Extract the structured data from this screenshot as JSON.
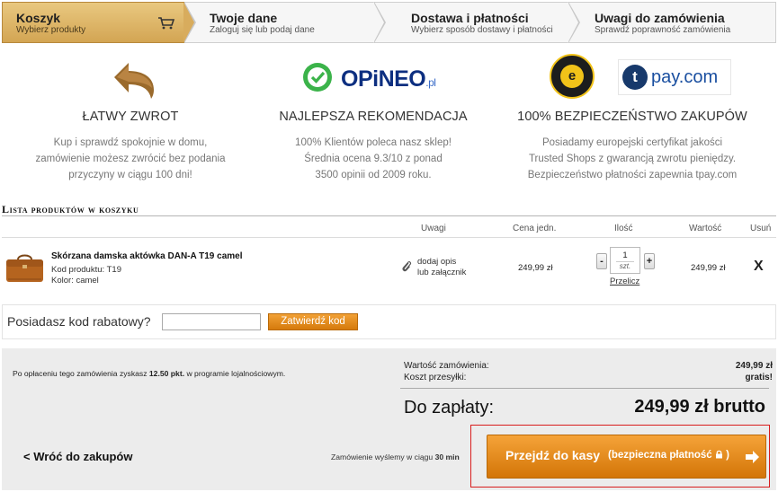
{
  "steps": [
    {
      "title": "Koszyk",
      "subtitle": "Wybierz produkty"
    },
    {
      "title": "Twoje dane",
      "subtitle": "Zaloguj się lub podaj dane"
    },
    {
      "title": "Dostawa i płatności",
      "subtitle": "Wybierz sposób dostawy i płatności"
    },
    {
      "title": "Uwagi do zamówienia",
      "subtitle": "Sprawdź poprawność zamówienia"
    }
  ],
  "features": [
    {
      "title": "ŁATWY ZWROT",
      "lines": [
        "Kup i sprawdź spokojnie w domu,",
        "zamówienie możesz zwrócić bez podania",
        "przyczyny w ciągu 100 dni!"
      ]
    },
    {
      "title": "NAJLEPSZA REKOMENDACJA",
      "lines": [
        "100% Klientów poleca nasz sklep!",
        "Średnia ocena 9.3/10 z ponad",
        "3500 opinii od 2009 roku."
      ]
    },
    {
      "title": "100% BEZPIECZEŃSTWO ZAKUPÓW",
      "lines": [
        "Posiadamy europejski certyfikat jakości",
        "Trusted Shops z gwarancją zwrotu pieniędzy.",
        "Bezpieczeństwo płatności zapewnia tpay.com"
      ]
    }
  ],
  "logos": {
    "opineo": "OPiNEO",
    "opineo_suffix": ".pl",
    "tpay_t": "t",
    "tpay": "pay.com",
    "trusted_shops_mark": "e"
  },
  "list": {
    "title": "Lista produktów w koszyku",
    "headers": {
      "notes": "Uwagi",
      "unit_price": "Cena jedn.",
      "quantity": "Ilość",
      "value": "Wartość",
      "remove": "Usuń"
    }
  },
  "product": {
    "name": "Skórzana damska aktówka DAN-A T19 camel",
    "code": "Kod produktu: T19",
    "color": "Kolor: camel",
    "note_line1": "dodaj opis",
    "note_line2": "lub załącznik",
    "unit_price": "249,99 zł",
    "quantity": "1",
    "unit": "szt.",
    "minus": "-",
    "plus": "+",
    "recalc": "Przelicz",
    "value": "249,99 zł",
    "remove": "X"
  },
  "discount": {
    "label": "Posiadasz kod rabatowy?",
    "input_value": "",
    "button": "Zatwierdź kod"
  },
  "summary": {
    "loyalty_pre": "Po opłaceniu tego zamówienia zyskasz ",
    "loyalty_points": "12.50 pkt.",
    "loyalty_post": " w programie lojalnościowym.",
    "order_value_label": "Wartość zamówienia:",
    "order_value": "249,99 zł",
    "shipping_label": "Koszt przesyłki:",
    "shipping": "gratis!",
    "to_pay_label": "Do zapłaty:",
    "total": "249,99 zł brutto",
    "back": "< Wróć do zakupów",
    "ship_pre": "Zamówienie wyślemy w ciągu ",
    "ship_time": "30 min",
    "checkout": "Przejdź do kasy",
    "checkout_sub": "(bezpieczna płatność",
    "checkout_sub_end": ")"
  },
  "colors": {
    "accent": "#e08a1a",
    "step_active": "#dcb068",
    "highlight": "#d81d1d",
    "opineo": "#0d2f80",
    "tpay": "#1a4fa0"
  }
}
